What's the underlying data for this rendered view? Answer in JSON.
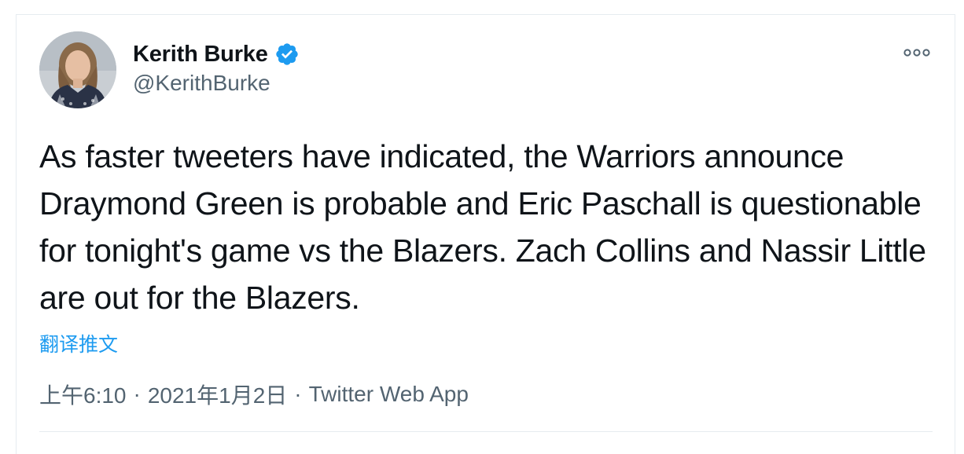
{
  "author": {
    "name": "Kerith Burke",
    "handle": "@KerithBurke",
    "verified": true,
    "verified_color": "#1d9bf0"
  },
  "tweet": {
    "text": "As faster tweeters have indicated, the Warriors announce Draymond Green is probable and Eric Paschall is questionable for tonight's game vs the Blazers. Zach Collins and Nassir Little are out for the Blazers.",
    "translate_label": "翻译推文",
    "time": "上午6:10",
    "separator": "·",
    "date": "2021年1月2日",
    "source": "Twitter Web App"
  },
  "icons": {
    "more": "more-horizontal-icon",
    "verified": "verified-badge-icon",
    "avatar": "profile-photo"
  },
  "colors": {
    "text": "#0f1419",
    "secondary": "#536471",
    "link": "#1d9bf0",
    "border": "#e6ecf0"
  }
}
